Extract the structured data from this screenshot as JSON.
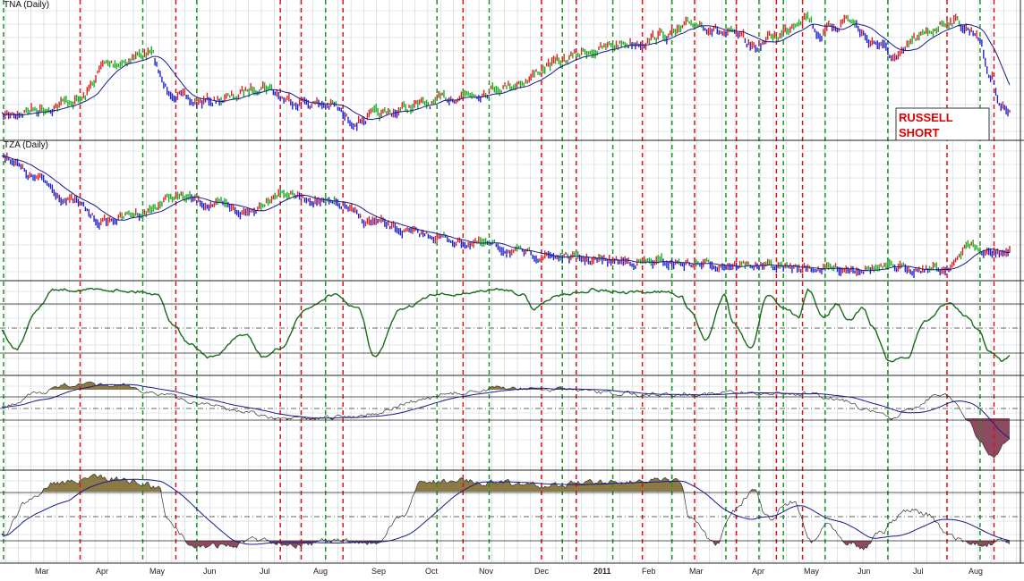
{
  "chart_data": {
    "type": "line",
    "panels": [
      {
        "id": "tna",
        "title": "TNA (Daily)",
        "series": "price-bars-with-moving-average"
      },
      {
        "id": "tza",
        "title": "TZA (Daily)",
        "series": "price-bars-with-moving-average"
      },
      {
        "id": "osc1",
        "title": "",
        "series": "oscillator-line"
      },
      {
        "id": "osc2",
        "title": "",
        "series": "histogram-line-with-moving-average"
      },
      {
        "id": "osc3",
        "title": "",
        "series": "histogram-line-with-moving-average"
      }
    ],
    "x_axis_labels": [
      "Mar",
      "Apr",
      "May",
      "Jun",
      "Jul",
      "Aug",
      "Sep",
      "Oct",
      "Nov",
      "Dec",
      "2011",
      "Feb",
      "Mar",
      "Apr",
      "May",
      "Jun",
      "Jul",
      "Aug"
    ],
    "x_axis_bold_labels": [
      "2011"
    ],
    "signal_lines": [
      {
        "signal": "buy",
        "date_index": 1
      },
      {
        "signal": "sell",
        "date_index": 45
      },
      {
        "signal": "buy",
        "date_index": 81
      },
      {
        "signal": "sell",
        "date_index": 100
      },
      {
        "signal": "buy",
        "date_index": 112
      },
      {
        "signal": "sell",
        "date_index": 160
      },
      {
        "signal": "sell",
        "date_index": 172
      },
      {
        "signal": "buy",
        "date_index": 186
      },
      {
        "signal": "sell",
        "date_index": 196
      },
      {
        "signal": "buy",
        "date_index": 250
      },
      {
        "signal": "sell",
        "date_index": 265
      },
      {
        "signal": "buy",
        "date_index": 280
      },
      {
        "signal": "sell",
        "date_index": 310
      },
      {
        "signal": "buy",
        "date_index": 322
      },
      {
        "signal": "sell",
        "date_index": 330
      },
      {
        "signal": "buy",
        "date_index": 351
      },
      {
        "signal": "sell",
        "date_index": 368
      },
      {
        "signal": "buy",
        "date_index": 385
      },
      {
        "signal": "sell",
        "date_index": 398
      },
      {
        "signal": "buy",
        "date_index": 416
      },
      {
        "signal": "sell",
        "date_index": 422
      },
      {
        "signal": "buy",
        "date_index": 435
      },
      {
        "signal": "sell",
        "date_index": 445
      },
      {
        "signal": "buy",
        "date_index": 449
      },
      {
        "signal": "sell",
        "date_index": 460
      },
      {
        "signal": "buy",
        "date_index": 473
      },
      {
        "signal": "buy",
        "date_index": 509
      },
      {
        "signal": "sell",
        "date_index": 543
      },
      {
        "signal": "buy",
        "date_index": 562
      },
      {
        "signal": "sell",
        "date_index": 570
      }
    ],
    "annotation": {
      "line1": "RUSSELL",
      "line2": "SHORT"
    },
    "colors": {
      "up_bar": "#22aa22",
      "down_bar": "#dd2222",
      "neutral_bar": "#2222cc",
      "moving_average": "#1a1a8a",
      "oscillator": "#1a6b1a",
      "positive_fill": "#8b7a45",
      "negative_fill": "#8e4a60",
      "buy_line": "#1a9a1a",
      "sell_line": "#e01010",
      "grid": "#c8cfdc"
    },
    "grid": true
  }
}
